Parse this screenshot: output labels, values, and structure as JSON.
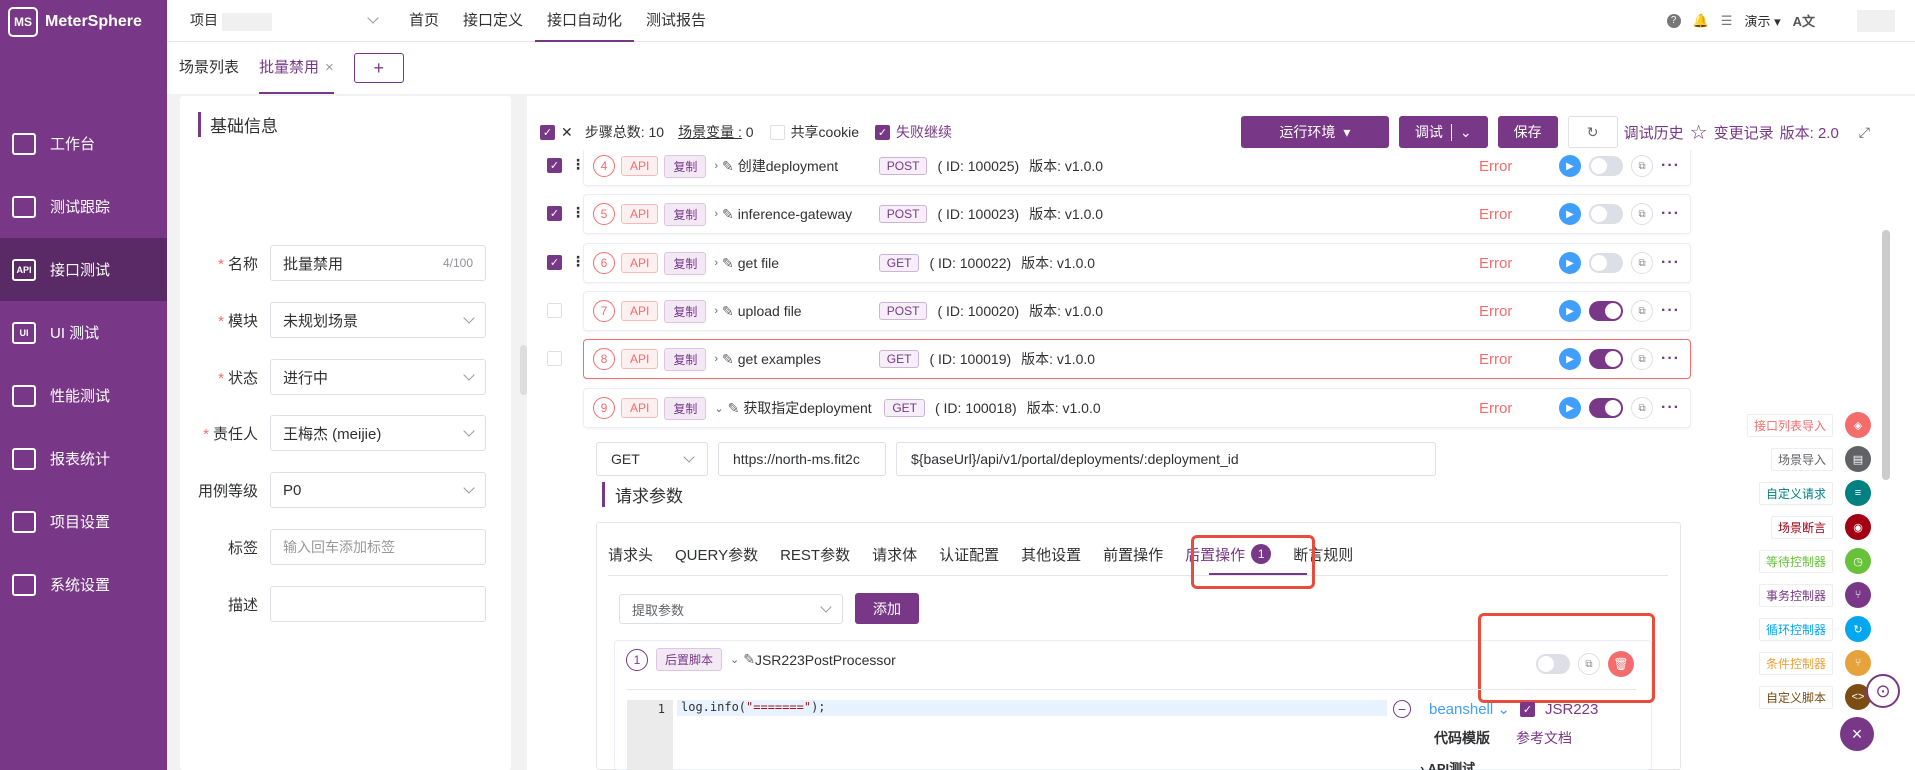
{
  "brand": {
    "name": "MeterSphere",
    "logo": "MS"
  },
  "sidebar": {
    "items": [
      {
        "label": "工作台",
        "icon": "monitor-icon"
      },
      {
        "label": "测试跟踪",
        "icon": "clipboard-icon"
      },
      {
        "label": "接口测试",
        "icon": "api-icon",
        "glyph": "API"
      },
      {
        "label": "UI 测试",
        "icon": "ui-icon",
        "glyph": "UI"
      },
      {
        "label": "性能测试",
        "icon": "chart-icon"
      },
      {
        "label": "报表统计",
        "icon": "report-icon"
      },
      {
        "label": "项目设置",
        "icon": "folder-icon"
      },
      {
        "label": "系统设置",
        "icon": "gears-icon"
      }
    ]
  },
  "header": {
    "project_label": "项目",
    "nav": [
      "首页",
      "接口定义",
      "接口自动化",
      "测试报告"
    ],
    "workspace": "演示",
    "lang_icon": "A文"
  },
  "tabs": {
    "items": [
      "场景列表",
      "批量禁用"
    ],
    "add": "+"
  },
  "basic": {
    "title": "基础信息",
    "fields": [
      {
        "label": "名称",
        "required": "*",
        "value": "批量禁用",
        "count": "4/100"
      },
      {
        "label": "模块",
        "required": "*",
        "value": "未规划场景"
      },
      {
        "label": "状态",
        "required": "*",
        "value": "进行中"
      },
      {
        "label": "责任人",
        "required": "*",
        "value": "王梅杰 (meijie)"
      },
      {
        "label": "用例等级",
        "value": "P0"
      },
      {
        "label": "标签",
        "placeholder": "输入回车添加标签"
      },
      {
        "label": "描述",
        "value": ""
      }
    ]
  },
  "toolbar": {
    "steps_label": "步骤总数:",
    "steps_value": "10",
    "vars_label": "场景变量 :",
    "vars_value": "0",
    "share_cookie": "共享cookie",
    "fail_continue": "失败继续",
    "env": "运行环境",
    "debug": "调试",
    "save": "保存",
    "debug_history": "调试历史",
    "change_log": "变更记录",
    "version": "版本: 2.0"
  },
  "steps": [
    {
      "num": "4",
      "type": "API",
      "copy": "复制",
      "name": "创建deployment",
      "method": "POST",
      "id": "( ID: 100025)",
      "version": "版本: v1.0.0",
      "status": "Error"
    },
    {
      "num": "5",
      "type": "API",
      "copy": "复制",
      "name": "inference-gateway",
      "method": "POST",
      "id": "( ID: 100023)",
      "version": "版本: v1.0.0",
      "status": "Error"
    },
    {
      "num": "6",
      "type": "API",
      "copy": "复制",
      "name": "get file",
      "method": "GET",
      "id": "( ID: 100022)",
      "version": "版本: v1.0.0",
      "status": "Error"
    },
    {
      "num": "7",
      "type": "API",
      "copy": "复制",
      "name": "upload file",
      "method": "POST",
      "id": "( ID: 100020)",
      "version": "版本: v1.0.0",
      "status": "Error"
    },
    {
      "num": "8",
      "type": "API",
      "copy": "复制",
      "name": "get examples",
      "method": "GET",
      "id": "( ID: 100019)",
      "version": "版本: v1.0.0",
      "status": "Error"
    },
    {
      "num": "9",
      "type": "API",
      "copy": "复制",
      "name": "获取指定deployment",
      "method": "GET",
      "id": "( ID: 100018)",
      "version": "版本: v1.0.0",
      "status": "Error"
    }
  ],
  "request": {
    "method": "GET",
    "host": "https://north-ms.fit2c",
    "path": "${baseUrl}/api/v1/portal/deployments/:deployment_id",
    "section_title": "请求参数",
    "tabs": [
      "请求头",
      "QUERY参数",
      "REST参数",
      "请求体",
      "认证配置",
      "其他设置",
      "前置操作",
      "后置操作",
      "断言规则"
    ],
    "post_badge": "1",
    "extract_placeholder": "提取参数",
    "add_button": "添加"
  },
  "processor": {
    "num": "1",
    "tag": "后置脚本",
    "name": "JSR223PostProcessor",
    "line_no": "1",
    "code_prefix": "log.info(",
    "code_string": "\"=======\"",
    "code_suffix": ");",
    "language": "beanshell",
    "jsr": "JSR223",
    "template": "代码模版",
    "doc": "参考文档",
    "api_test": "API测试"
  },
  "palette": [
    {
      "label": "接口列表导入",
      "color": "#f56c6c",
      "icon": "import-icon",
      "glyph": "◈"
    },
    {
      "label": "场景导入",
      "color": "#606266",
      "icon": "scene-icon",
      "glyph": "▤"
    },
    {
      "label": "自定义请求",
      "color": "#008080",
      "icon": "custom-request-icon",
      "glyph": "≡"
    },
    {
      "label": "场景断言",
      "color": "#a30014",
      "icon": "assert-icon",
      "glyph": "◉"
    },
    {
      "label": "等待控制器",
      "color": "#67c23a",
      "icon": "wait-icon",
      "glyph": "◷"
    },
    {
      "label": "事务控制器",
      "color": "#783887",
      "icon": "transaction-icon",
      "glyph": "⑂"
    },
    {
      "label": "循环控制器",
      "color": "#02a7f0",
      "icon": "loop-icon",
      "glyph": "↻"
    },
    {
      "label": "条件控制器",
      "color": "#e6a23c",
      "icon": "condition-icon",
      "glyph": "⑂"
    },
    {
      "label": "自定义脚本",
      "color": "#7b4d12",
      "icon": "script-icon",
      "glyph": "<>"
    }
  ]
}
